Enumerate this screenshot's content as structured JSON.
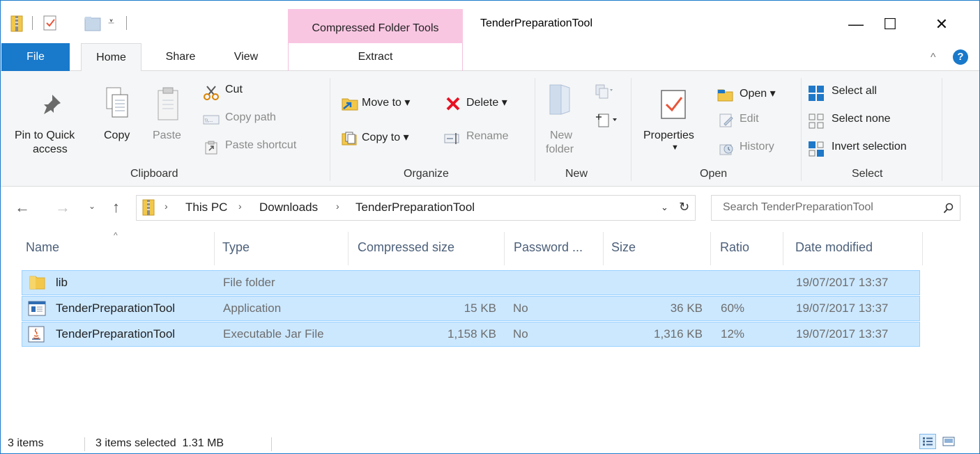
{
  "window": {
    "title": "TenderPreparationTool",
    "context_tab_group": "Compressed Folder Tools",
    "controls": {
      "minimize": "—",
      "maximize": "☐",
      "close": "✕"
    }
  },
  "tabs": [
    {
      "label": "File"
    },
    {
      "label": "Home"
    },
    {
      "label": "Share"
    },
    {
      "label": "View"
    },
    {
      "label": "Extract"
    }
  ],
  "ribbon": {
    "clipboard": {
      "group_label": "Clipboard",
      "pin": [
        "Pin to Quick",
        "access"
      ],
      "copy": "Copy",
      "paste": "Paste",
      "cut": "Cut",
      "copy_path": "Copy path",
      "paste_shortcut": "Paste shortcut"
    },
    "organize": {
      "group_label": "Organize",
      "move_to": "Move to ▾",
      "copy_to": "Copy to ▾",
      "delete": "Delete ▾",
      "rename": "Rename"
    },
    "new": {
      "group_label": "New",
      "new_folder": [
        "New",
        "folder"
      ]
    },
    "open": {
      "group_label": "Open",
      "properties": "Properties",
      "open": "Open ▾",
      "edit": "Edit",
      "history": "History"
    },
    "select": {
      "group_label": "Select",
      "select_all": "Select all",
      "select_none": "Select none",
      "invert_selection": "Invert selection"
    }
  },
  "address": {
    "breadcrumbs": [
      "This PC",
      "Downloads",
      "TenderPreparationTool"
    ],
    "search_placeholder": "Search TenderPreparationTool"
  },
  "columns": [
    "Name",
    "Type",
    "Compressed size",
    "Password ...",
    "Size",
    "Ratio",
    "Date modified"
  ],
  "files": [
    {
      "name": "lib",
      "type": "File folder",
      "compressed": "",
      "password": "",
      "size": "",
      "ratio": "",
      "date": "19/07/2017 13:37",
      "icon": "folder-icon"
    },
    {
      "name": "TenderPreparationTool",
      "type": "Application",
      "compressed": "15 KB",
      "password": "No",
      "size": "36 KB",
      "ratio": "60%",
      "date": "19/07/2017 13:37",
      "icon": "application-icon"
    },
    {
      "name": "TenderPreparationTool",
      "type": "Executable Jar File",
      "compressed": "1,158 KB",
      "password": "No",
      "size": "1,316 KB",
      "ratio": "12%",
      "date": "19/07/2017 13:37",
      "icon": "java-jar-icon"
    }
  ],
  "status": {
    "item_count": "3 items",
    "selected": "3 items selected  1.31 MB"
  },
  "colors": {
    "accent": "#1979ca",
    "context_tab": "#f9c6e2",
    "selection": "#cce8ff",
    "selection_border": "#99d1ff",
    "delete_red": "#e81123"
  }
}
